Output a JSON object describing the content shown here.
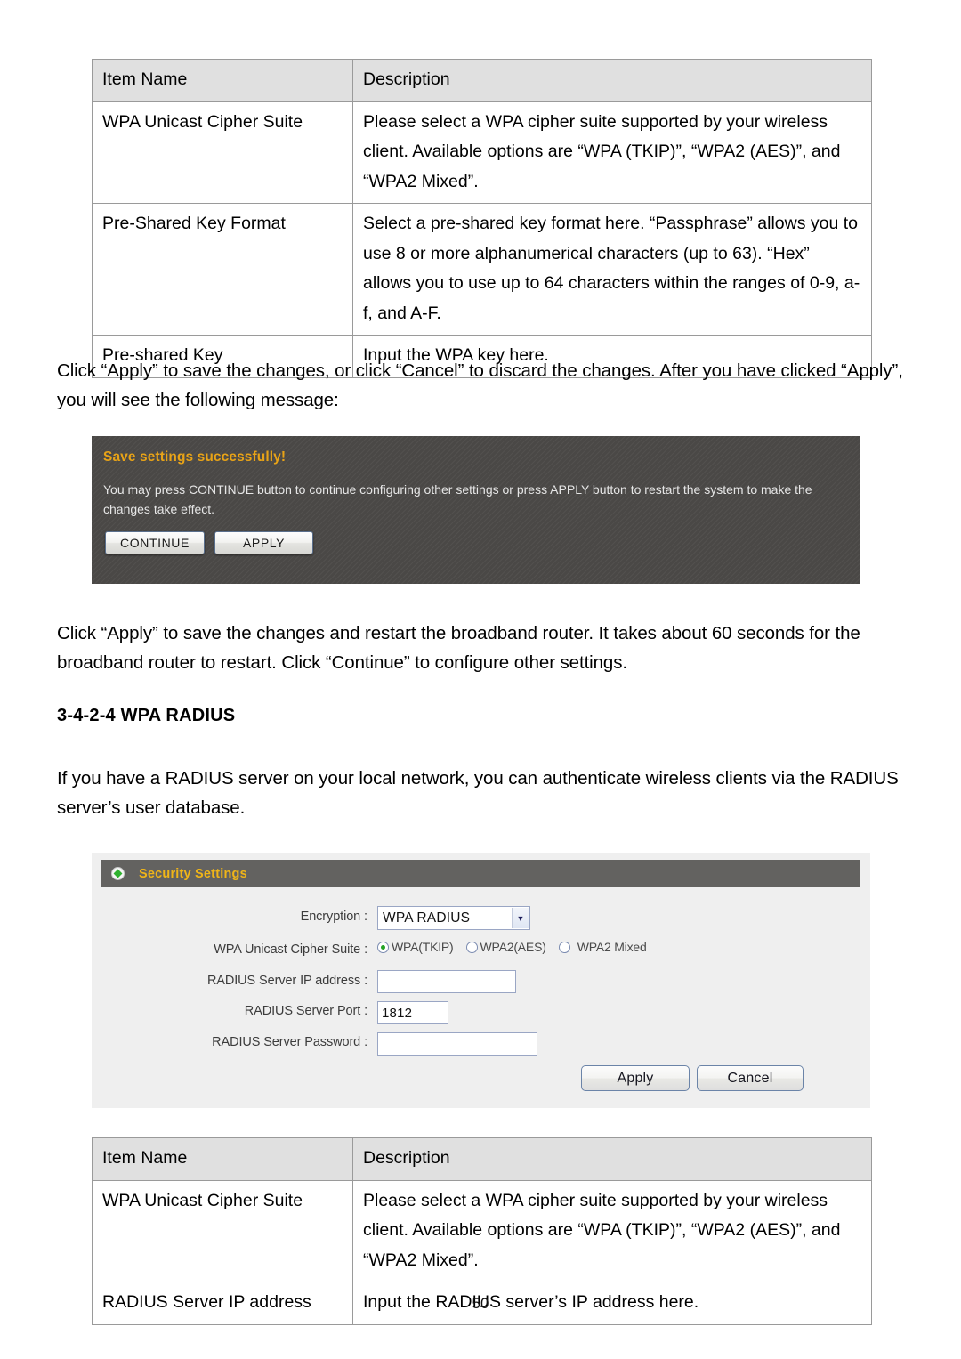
{
  "page": {
    "number": "50"
  },
  "table_top": {
    "headers": [
      "Item Name",
      "Description"
    ],
    "rows": [
      {
        "item": "WPA Unicast Cipher Suite",
        "desc": "Please select a WPA cipher suite supported by your wireless client. Available options are “WPA (TKIP)”, “WPA2 (AES)”, and “WPA2 Mixed”."
      },
      {
        "item": "Pre-Shared Key Format",
        "desc": "Select a pre-shared key format here. “Passphrase” allows you to use 8 or more alphanumerical characters (up to 63). “Hex” allows you to use up to 64 characters within the ranges of 0-9, a-f, and A-F."
      },
      {
        "item": "Pre-shared Key",
        "desc": "Input the WPA key here."
      }
    ]
  },
  "para_apply_cancel": "Click “Apply” to save the changes, or click “Cancel” to discard the changes. After you have clicked “Apply”, you will see the following message:",
  "message_box": {
    "title": "Save settings successfully!",
    "body": "You may press CONTINUE button to continue configuring other settings or press APPLY button to restart the system to make the changes take effect.",
    "buttons": [
      "CONTINUE",
      "APPLY"
    ],
    "title_color": "#e8a317",
    "background_color": "#4a4846"
  },
  "para_restart": "Click “Apply” to save the changes and restart the broadband router. It takes about 60 seconds for the broadband router to restart. Click “Continue” to configure other settings.",
  "section_heading": "3-4-2-4 WPA RADIUS",
  "para_radius": "If you have a RADIUS server on your local network, you can authenticate wireless clients via the RADIUS server’s user database.",
  "panel": {
    "title": "Security Settings",
    "title_color": "#f0b518",
    "header_color": "#636260",
    "body_color": "#efefef",
    "bullet_icon": "green-diamond-icon",
    "fields": {
      "encryption": {
        "label": "Encryption :",
        "value": "WPA RADIUS",
        "caret_icon": "chevron-down-icon"
      },
      "cipher_suite": {
        "label": "WPA Unicast Cipher Suite :",
        "options": [
          {
            "label": "WPA(TKIP)",
            "selected": true
          },
          {
            "label": "WPA2(AES)",
            "selected": false
          },
          {
            "label": "WPA2 Mixed",
            "selected": false
          }
        ]
      },
      "radius_ip": {
        "label": "RADIUS Server IP address :",
        "value": ""
      },
      "radius_port": {
        "label": "RADIUS Server Port :",
        "value": "1812"
      },
      "radius_password": {
        "label": "RADIUS Server Password :",
        "value": ""
      }
    },
    "buttons": {
      "apply": "Apply",
      "cancel": "Cancel"
    }
  },
  "table_bottom": {
    "headers": [
      "Item Name",
      "Description"
    ],
    "rows": [
      {
        "item": "WPA Unicast Cipher Suite",
        "desc": "Please select a WPA cipher suite supported by your wireless client. Available options are “WPA (TKIP)”, “WPA2 (AES)”, and “WPA2 Mixed”."
      },
      {
        "item": "RADIUS Server IP address",
        "desc": "Input the RADIUS server’s IP address here."
      }
    ]
  }
}
